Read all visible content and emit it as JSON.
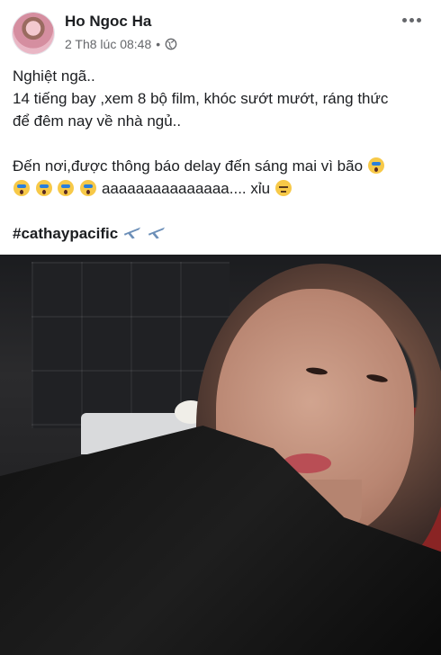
{
  "post": {
    "author": "Ho Ngoc Ha",
    "timestamp": "2 Th8 lúc 08:48",
    "privacy_icon": "globe-icon",
    "menu_icon": "more-options-icon"
  },
  "content": {
    "line1": "Nghiệt ngã..",
    "line2": "14 tiếng bay ,xem 8 bộ film, khóc sướt mướt, ráng thức",
    "line3": "để đêm nay về nhà ngủ..",
    "line4": "Đến nơi,được thông  báo delay đến sáng mai vì bão",
    "line5_text": "aaaaaaaaaaaaaaa.... xỉu",
    "hashtag": "#cathaypacific"
  },
  "photo": {
    "description_icon": "selfie-photo"
  }
}
